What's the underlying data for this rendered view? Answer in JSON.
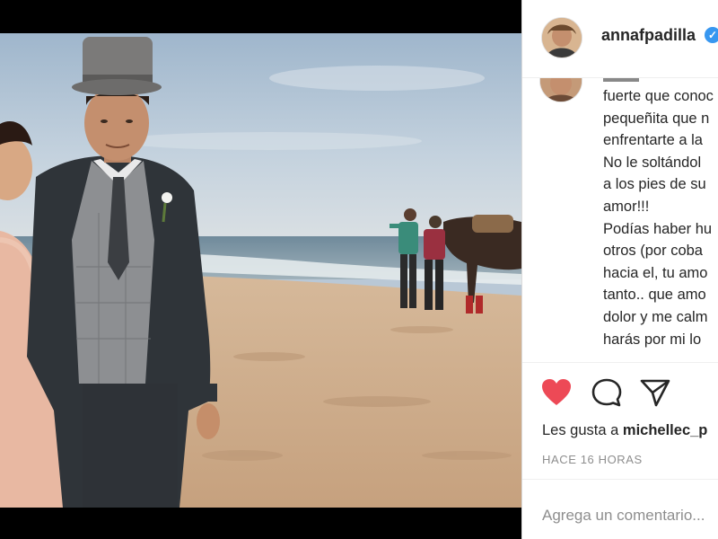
{
  "post": {
    "author": "annafpadilla",
    "verified_badge": "✓"
  },
  "comment": {
    "lines": [
      "fuerte que conoc",
      "pequeñita que n",
      "enfrentarte a la",
      "No le soltándol",
      "a los pies de su",
      "amor!!!",
      "Podías haber hu",
      "otros (por coba",
      "hacia el, tu amo",
      "tanto.. que amo",
      "dolor y me calm",
      "harás por mi lo"
    ]
  },
  "actions": {
    "like_icon": "heart-filled-icon",
    "comment_icon": "comment-bubble-icon",
    "share_icon": "paper-plane-icon",
    "like_color": "#ed4956",
    "likes_prefix": "Les gusta a ",
    "likes_user": "michellec_p",
    "time_ago": "HACE 16 HORAS"
  },
  "comment_box": {
    "placeholder": "Agrega un comentario..."
  }
}
